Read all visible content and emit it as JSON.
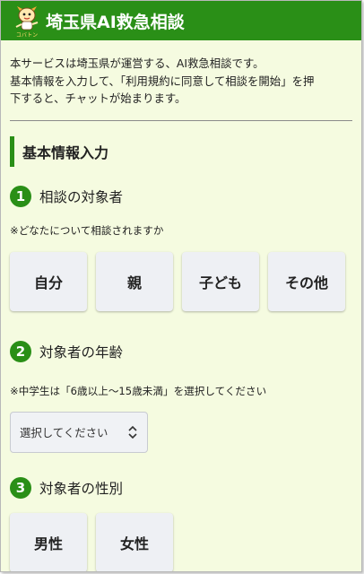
{
  "header": {
    "title": "埼玉県AI救急相談",
    "logo_caption": "コバトン",
    "accent_color": "#2a8f17"
  },
  "intro": {
    "line1": "本サービスは埼玉県が運営する、AI救急相談です。",
    "line2": "基本情報を入力して、「利用規約に同意して相談を開始」を押",
    "line3": "下すると、チャットが始まります。"
  },
  "section": {
    "title": "基本情報入力"
  },
  "questions": [
    {
      "number": "1",
      "label": "相談の対象者",
      "note": "※どなたについて相談されますか",
      "options": [
        "自分",
        "親",
        "子ども",
        "その他"
      ]
    },
    {
      "number": "2",
      "label": "対象者の年齢",
      "note": "※中学生は「6歳以上～15歳未満」を選択してください",
      "select_value": "選択してください"
    },
    {
      "number": "3",
      "label": "対象者の性別",
      "options": [
        "男性",
        "女性"
      ]
    }
  ],
  "icons": {
    "logo": "mascot-logo-icon",
    "select_arrows": "up-down-chevron-icon"
  }
}
